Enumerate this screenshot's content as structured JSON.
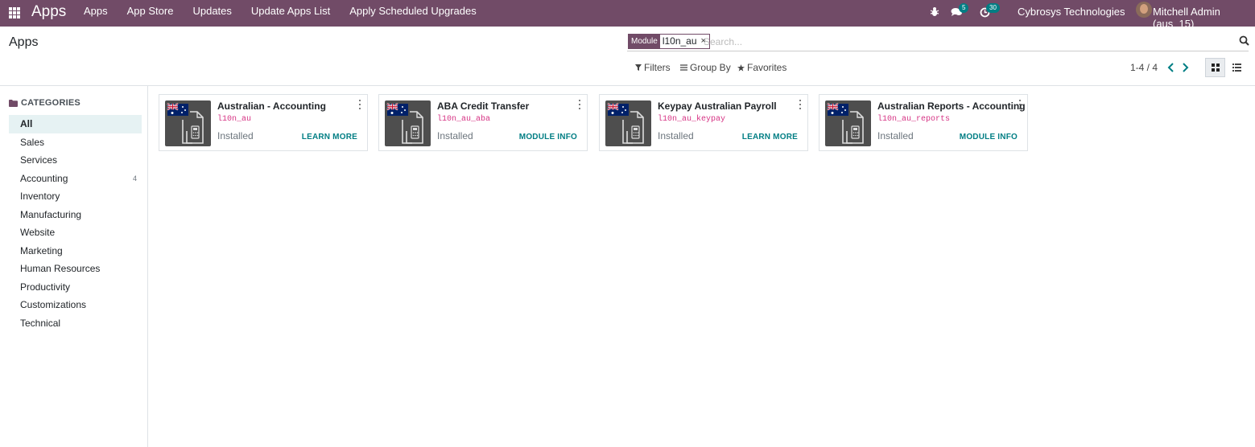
{
  "navbar": {
    "brand": "Apps",
    "menu": [
      "Apps",
      "App Store",
      "Updates",
      "Update Apps List",
      "Apply Scheduled Upgrades"
    ],
    "messages_count": "5",
    "activities_count": "30",
    "company": "Cybrosys Technologies",
    "user": "Mitchell Admin (aus_15)",
    "color": "#714B67"
  },
  "control_panel": {
    "title": "Apps",
    "facet_label": "Module",
    "facet_value": "l10n_au",
    "facet_remove": "×",
    "search_placeholder": "Search...",
    "filters": "Filters",
    "group_by": "Group By",
    "favorites": "Favorites",
    "pager": "1-4 / 4"
  },
  "sidebar": {
    "header": "CATEGORIES",
    "items": [
      {
        "label": "All",
        "count": ""
      },
      {
        "label": "Sales",
        "count": ""
      },
      {
        "label": "Services",
        "count": ""
      },
      {
        "label": "Accounting",
        "count": "4"
      },
      {
        "label": "Inventory",
        "count": ""
      },
      {
        "label": "Manufacturing",
        "count": ""
      },
      {
        "label": "Website",
        "count": ""
      },
      {
        "label": "Marketing",
        "count": ""
      },
      {
        "label": "Human Resources",
        "count": ""
      },
      {
        "label": "Productivity",
        "count": ""
      },
      {
        "label": "Customizations",
        "count": ""
      },
      {
        "label": "Technical",
        "count": ""
      }
    ]
  },
  "modules": [
    {
      "name": "Australian - Accounting",
      "technical": "l10n_au",
      "status": "Installed",
      "action": "LEARN MORE"
    },
    {
      "name": "ABA Credit Transfer",
      "technical": "l10n_au_aba",
      "status": "Installed",
      "action": "MODULE INFO"
    },
    {
      "name": "Keypay Australian Payroll",
      "technical": "l10n_au_keypay",
      "status": "Installed",
      "action": "LEARN MORE"
    },
    {
      "name": "Australian Reports - Accounting",
      "technical": "l10n_au_reports",
      "status": "Installed",
      "action": "MODULE INFO"
    }
  ],
  "colors": {
    "primary": "#714B67",
    "link": "#017e84",
    "technical": "#d63384"
  }
}
